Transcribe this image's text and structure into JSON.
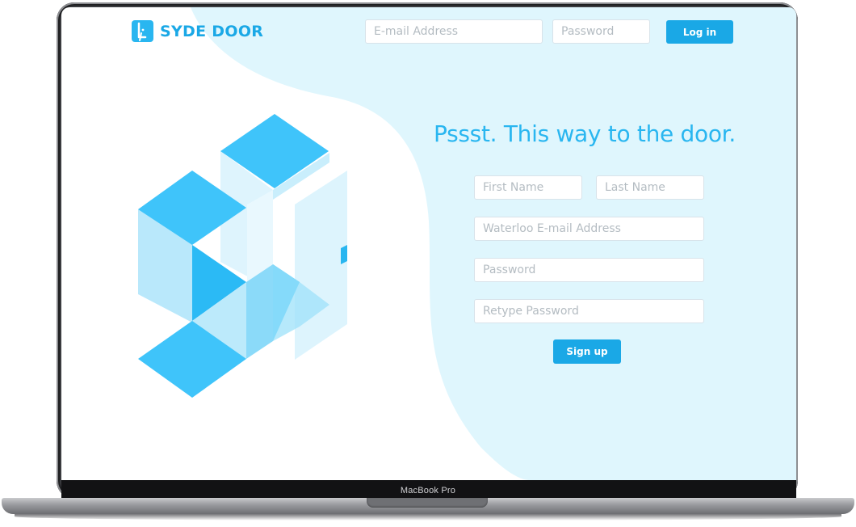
{
  "device": {
    "model_label": "MacBook Pro"
  },
  "brand": {
    "name": "SYDE DOOR",
    "icon": "door-logo-icon",
    "accent": "#1aa8e6",
    "light_accent": "#dff6fd"
  },
  "login": {
    "email_placeholder": "E-mail Address",
    "password_placeholder": "Password",
    "login_label": "Log in"
  },
  "signup": {
    "heading": "Pssst. This way to the door.",
    "first_name_placeholder": "First Name",
    "last_name_placeholder": "Last Name",
    "email_placeholder": "Waterloo E-mail Address",
    "password_placeholder": "Password",
    "retype_password_placeholder": "Retype Password",
    "signup_label": "Sign up"
  }
}
